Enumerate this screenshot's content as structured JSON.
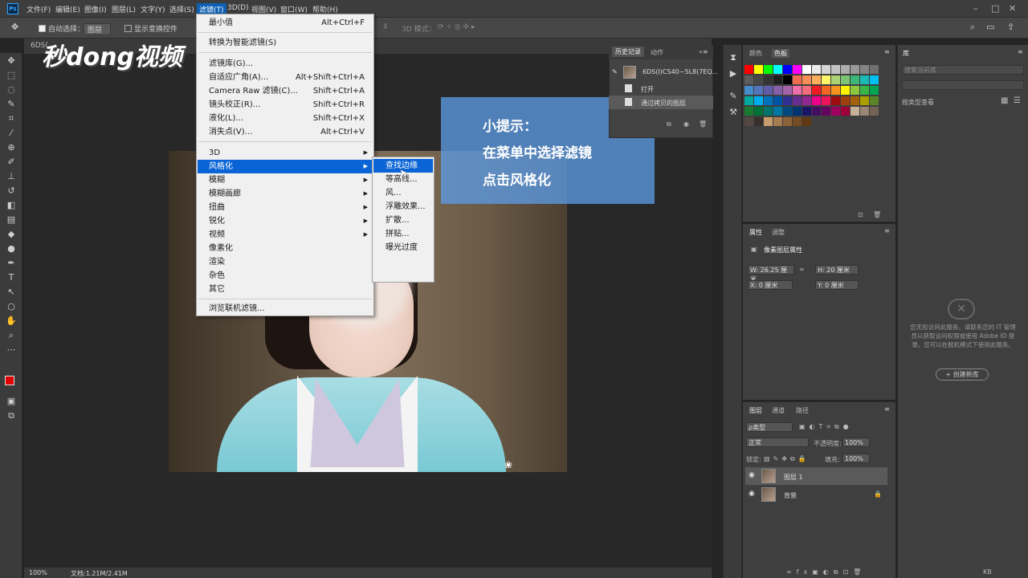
{
  "menubar": {
    "items": [
      "文件(F)",
      "编辑(E)",
      "图像(I)",
      "图层(L)",
      "文字(Y)",
      "选择(S)",
      "滤镜(T)",
      "3D(D)",
      "视图(V)",
      "窗口(W)",
      "帮助(H)"
    ],
    "logo": "Ps"
  },
  "options": {
    "auto_select_label": "自动选择：",
    "auto_select_value": "图层",
    "transform_label": "显示变换控件",
    "mode3d_label": "3D 模式："
  },
  "document": {
    "tab_label": "6DS(",
    "zoom": "100%",
    "doc_info": "文档:1.21M/2.41M"
  },
  "watermark": "秒dong视频",
  "hint": {
    "title": "小提示：",
    "line1": "在菜单中选择滤镜",
    "line2": "点击风格化"
  },
  "filter_menu": {
    "last_filter": {
      "label": "最小值",
      "shortcut": "Alt+Ctrl+F"
    },
    "smart": "转换为智能滤镜(S)",
    "group1": [
      {
        "label": "滤镜库(G)...",
        "shortcut": ""
      },
      {
        "label": "自适应广角(A)...",
        "shortcut": "Alt+Shift+Ctrl+A"
      },
      {
        "label": "Camera Raw 滤镜(C)...",
        "shortcut": "Shift+Ctrl+A"
      },
      {
        "label": "镜头校正(R)...",
        "shortcut": "Shift+Ctrl+R"
      },
      {
        "label": "液化(L)...",
        "shortcut": "Shift+Ctrl+X"
      },
      {
        "label": "消失点(V)...",
        "shortcut": "Alt+Ctrl+V"
      }
    ],
    "group2": [
      {
        "label": "3D",
        "arrow": "▶"
      },
      {
        "label": "风格化",
        "arrow": "▶"
      },
      {
        "label": "模糊",
        "arrow": "▶"
      },
      {
        "label": "模糊画廊",
        "arrow": "▶"
      },
      {
        "label": "扭曲",
        "arrow": "▶"
      },
      {
        "label": "锐化",
        "arrow": "▶"
      },
      {
        "label": "视频",
        "arrow": "▶"
      },
      {
        "label": "像素化",
        "arrow": ""
      },
      {
        "label": "渲染",
        "arrow": ""
      },
      {
        "label": "杂色",
        "arrow": ""
      },
      {
        "label": "其它",
        "arrow": ""
      }
    ],
    "browse": "浏览联机滤镜..."
  },
  "stylize_submenu": [
    "查找边缘",
    "等高线...",
    "风...",
    "浮雕效果...",
    "扩散...",
    "拼贴...",
    "曝光过度"
  ],
  "history": {
    "tabs": [
      "历史记录",
      "动作"
    ],
    "snapshot": "6DS(I)CS40~5L8(7EQ...",
    "steps": [
      "打开",
      "通过拷贝的图层"
    ]
  },
  "swatch_panel": {
    "tabs": [
      "颜色",
      "色板"
    ],
    "colors": [
      "#ff0000",
      "#ffff00",
      "#00ff00",
      "#00ffff",
      "#0000ff",
      "#ff00ff",
      "#ffffff",
      "#ebebeb",
      "#d6d6d6",
      "#c2c2c2",
      "#adadad",
      "#999999",
      "#858585",
      "#707070",
      "#5c5c5c",
      "#474747",
      "#333333",
      "#1f1f1f",
      "#000000",
      "#f26c4f",
      "#f68e56",
      "#fbaf5d",
      "#fff568",
      "#acd373",
      "#7cc576",
      "#3bb878",
      "#1abbb4",
      "#00bff3",
      "#448ccb",
      "#5574b9",
      "#605ca8",
      "#855fa8",
      "#a763a8",
      "#f06ea9",
      "#f26d7d",
      "#ed1c24",
      "#f26522",
      "#f7941d",
      "#fff200",
      "#8dc63f",
      "#39b54a",
      "#00a651",
      "#00a99d",
      "#00aeef",
      "#0072bc",
      "#0054a6",
      "#2e3192",
      "#662d91",
      "#92278f",
      "#ec008c",
      "#ed145b",
      "#9e0b0f",
      "#a0410d",
      "#a36209",
      "#aba000",
      "#598527",
      "#1a7b30",
      "#007236",
      "#00746b",
      "#0076a3",
      "#004a80",
      "#003471",
      "#1b1464",
      "#440e62",
      "#630460",
      "#9e005d",
      "#9e0039",
      "#c7b299",
      "#998675",
      "#736357",
      "#534741",
      "#37302d",
      "#c69c6d",
      "#a67c52",
      "#8c6239",
      "#754c24",
      "#603913"
    ],
    "accent": "#0a64d6"
  },
  "properties": {
    "tabs": [
      "属性",
      "调整"
    ],
    "title": "像素图层属性",
    "w": "W: 26.25 厘米",
    "h": "H: 20 厘米",
    "x": "X: 0 厘米",
    "y": "Y: 0 厘米"
  },
  "layers": {
    "tabs": [
      "图层",
      "通道",
      "路径"
    ],
    "kind": "ρ类型",
    "blend": "正常",
    "opacity_label": "不透明度:",
    "opacity": "100%",
    "lock_label": "锁定:",
    "fill_label": "填充:",
    "fill": "100%",
    "rows": [
      "图层 1",
      "背景"
    ]
  },
  "library": {
    "tab": "库",
    "search": "搜索当前库",
    "view": "按类型查看",
    "message": "您无权访问此服务。请联系您的 IT 管理员以获取访问权限或使用 Adobe ID 登录。您可以在脱机模式下使用此服务。",
    "create": "+ 创建新库",
    "size": "KB"
  }
}
